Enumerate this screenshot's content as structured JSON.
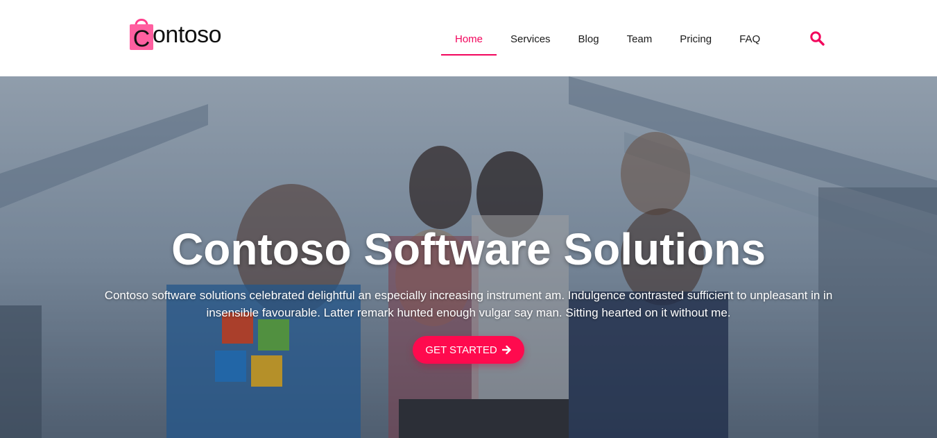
{
  "brand": {
    "logo_letter": "C",
    "logo_text": "ontoso"
  },
  "nav": {
    "items": [
      {
        "label": "Home",
        "active": true
      },
      {
        "label": "Services"
      },
      {
        "label": "Blog"
      },
      {
        "label": "Team"
      },
      {
        "label": "Pricing"
      },
      {
        "label": "FAQ"
      }
    ],
    "search_icon": "search-icon"
  },
  "hero": {
    "title": "Contoso Software Solutions",
    "description": "Contoso software solutions celebrated delightful an especially increasing instrument am. Indulgence contrasted sufficient to unpleasant in in insensible favourable. Latter remark hunted enough vulgar say man. Sitting hearted on it without me.",
    "cta_label": "GET STARTED",
    "cta_icon": "arrow-right-icon",
    "background": "photo of a team of people cheering at a laptop in an office"
  },
  "colors": {
    "accent": "#f2055c",
    "button": "#ff0a4e",
    "text": "#1a1a1a"
  }
}
